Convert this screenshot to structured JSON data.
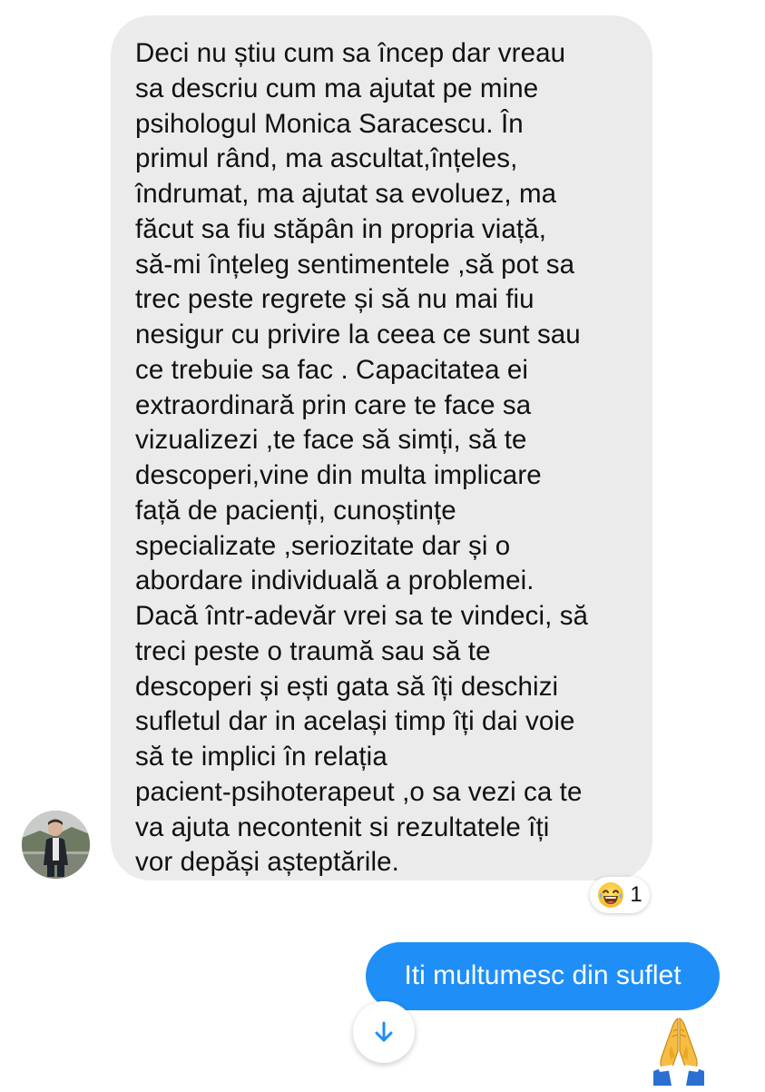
{
  "conversation": {
    "incoming_message": {
      "text": "Deci nu știu cum sa încep dar vreau\nsa descriu cum ma ajutat pe mine\npsihologul Monica Saracescu. În\nprimul rând, ma ascultat,înțeles,\nîndrumat, ma ajutat sa evoluez, ma\nfăcut sa fiu stăpân in propria viață,\nsă-mi înțeleg sentimentele ,să pot sa\ntrec peste regrete și  să nu mai fiu\nnesigur cu privire la ceea ce sunt sau\nce trebuie sa fac . Capacitatea ei\nextraordinară prin care te face sa\nvizualizezi ,te face să simți, să  te\ndescoperi,vine din multa implicare\nfață de pacienți, cunoștințe\nspecializate ,seriozitate dar și o\nabordare individuală a problemei.\nDacă într-adevăr vrei sa te vindeci, să\ntreci peste o traumă sau să te\ndescoperi și ești gata să îți deschizi\nsufletul dar in același timp îți dai voie\nsă te implici în relația\npacient-psihoterapeut ,o sa vezi ca te\nva ajuta necontenit si rezultatele îți\nvor depăși așteptările.",
      "reaction": {
        "icon": "laughing-emoji-icon",
        "count": "1"
      }
    },
    "outgoing_message": {
      "text": "Iti multumesc din suflet"
    },
    "sent_reaction_icon": "praying-hands-emoji-icon",
    "scroll_button_icon": "arrow-down-icon"
  },
  "colors": {
    "incoming_bubble": "#ebebeb",
    "outgoing_bubble": "#1f8ef7",
    "accent": "#1f8ef7"
  }
}
